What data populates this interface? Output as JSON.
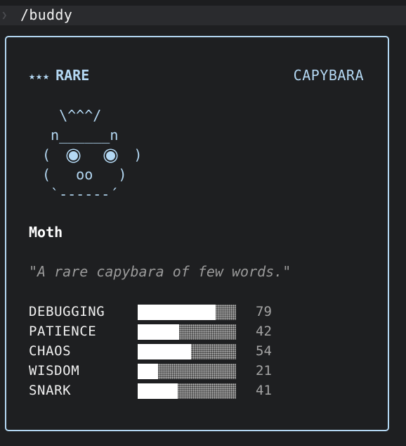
{
  "command": {
    "prompt_icon": "chevron-right-icon",
    "text": "/buddy"
  },
  "card": {
    "rarity_stars": "★★★",
    "rarity_label": "RARE",
    "species": "CAPYBARA",
    "accent_color": "#b4d8f3",
    "art": {
      "line1": "  \\^^^/",
      "line2_left": " n",
      "line2_mid": "______",
      "line2_right": "n",
      "line3_left": "(",
      "line3_right": ")",
      "line4_left": "(   ",
      "line4_mid": "oo",
      "line4_right": "   )",
      "line5": " `------´"
    },
    "name": "Moth",
    "quote": "\"A rare capybara of few words.\"",
    "stats": [
      {
        "label": "DEBUGGING",
        "value": 79
      },
      {
        "label": "PATIENCE",
        "value": 42
      },
      {
        "label": "CHAOS",
        "value": 54
      },
      {
        "label": "WISDOM",
        "value": 21
      },
      {
        "label": "SNARK",
        "value": 41
      }
    ]
  }
}
